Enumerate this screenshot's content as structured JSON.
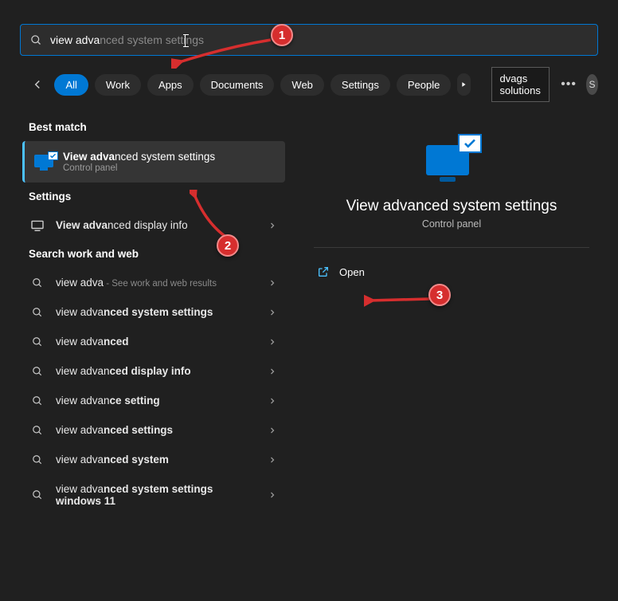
{
  "search": {
    "typed": "view adva",
    "suggestion": "nced system settings"
  },
  "filters": {
    "items": [
      "All",
      "Work",
      "Apps",
      "Documents",
      "Web",
      "Settings",
      "People"
    ],
    "tag": "dvags solutions",
    "avatar": "S"
  },
  "sections": {
    "best": "Best match",
    "settings": "Settings",
    "web": "Search work and web"
  },
  "best_match": {
    "title_bold": "View adva",
    "title_rest": "nced system settings",
    "subtitle": "Control panel"
  },
  "settings_items": [
    {
      "bold": "View adva",
      "rest": "nced display info"
    }
  ],
  "web_header": {
    "bold": "view adva",
    "rest": " - See work and web results"
  },
  "web_items": [
    {
      "pre": "view adva",
      "bold": "nced system settings"
    },
    {
      "pre": "view adva",
      "bold": "nced"
    },
    {
      "pre": "view advan",
      "bold": "ced display info"
    },
    {
      "pre": "view advan",
      "bold": "ce setting"
    },
    {
      "pre": "view adva",
      "bold": "nced settings"
    },
    {
      "pre": "view adva",
      "bold": "nced system"
    },
    {
      "pre": "view adva",
      "bold": "nced system settings windows 11"
    }
  ],
  "details": {
    "title": "View advanced system settings",
    "subtitle": "Control panel",
    "open": "Open"
  },
  "annotations": {
    "a1": "1",
    "a2": "2",
    "a3": "3"
  }
}
